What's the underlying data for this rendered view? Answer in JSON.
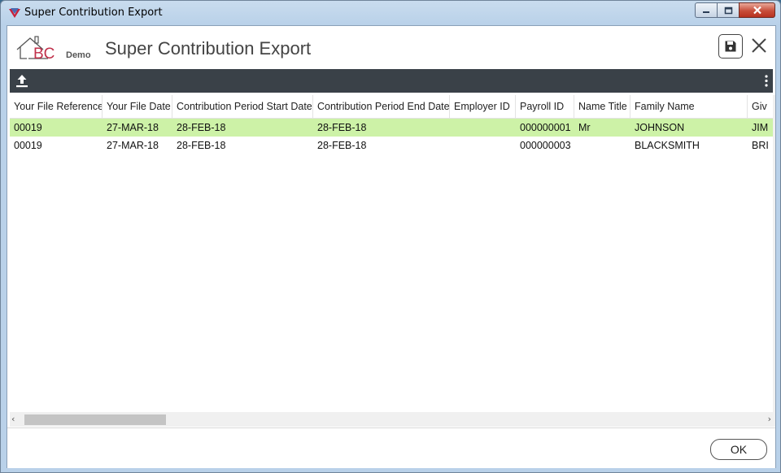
{
  "window": {
    "title": "Super Contribution Export",
    "minimize_label": "minimize",
    "maximize_label": "maximize",
    "close_label": "close"
  },
  "header": {
    "logo_text": "BC",
    "logo_tag": "Demo",
    "page_title": "Super Contribution Export",
    "save_icon": "save-icon",
    "close_icon": "close-icon"
  },
  "toolbar": {
    "upload_icon": "upload-icon",
    "more_icon": "more-vertical-icon",
    "background_color": "#3a4148"
  },
  "grid": {
    "columns": [
      "Your File Reference",
      "Your File Date",
      "Contribution Period Start Date",
      "Contribution Period End Date",
      "Employer ID",
      "Payroll ID",
      "Name Title",
      "Family Name",
      "Giv"
    ],
    "rows": [
      [
        "00019",
        "27-MAR-18",
        "28-FEB-18",
        "28-FEB-18",
        "",
        "000000001",
        "Mr",
        "JOHNSON",
        "JIM"
      ],
      [
        "00019",
        "27-MAR-18",
        "28-FEB-18",
        "28-FEB-18",
        "",
        "000000003",
        "",
        "BLACKSMITH",
        "BRI"
      ]
    ],
    "selected_row_color": "#cdf2a7"
  },
  "scrollbar": {
    "left_arrow": "‹",
    "right_arrow": "›"
  },
  "footer": {
    "ok_label": "OK"
  }
}
